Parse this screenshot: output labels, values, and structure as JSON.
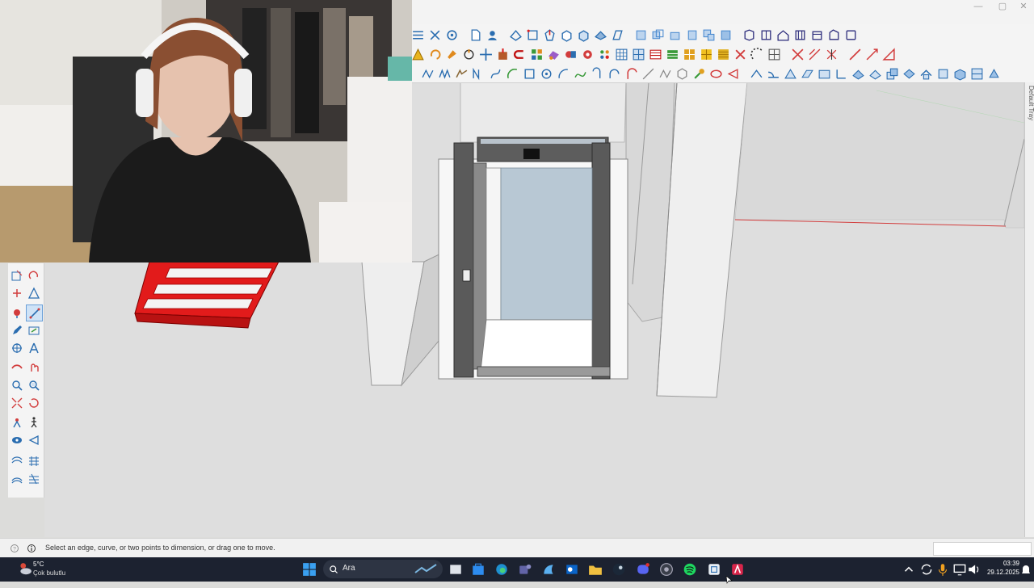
{
  "window": {
    "minimize": "—",
    "maximize": "▢",
    "close": "✕"
  },
  "tray": {
    "label": "Default Tray"
  },
  "status": {
    "text": "Select an edge, curve, or two points to dimension, or drag one to move.",
    "measurements_value": ""
  },
  "taskbar": {
    "weather_temp": "5°C",
    "weather_desc": "Çok bulutlu",
    "search_label": "Ara",
    "clock_time": "03:39",
    "clock_date": "29.12.2025",
    "apps": [
      "start",
      "search",
      "widget",
      "task-view",
      "store",
      "edge",
      "teams",
      "copilot",
      "outlook",
      "file-explorer",
      "steam",
      "discord",
      "chrome",
      "spotify",
      "sketchup",
      "app-red"
    ]
  },
  "colors": {
    "taskbar": "#1c2230",
    "viewport": "#dedede",
    "stair_red": "#e21b1b",
    "axis_red": "#d23c3c",
    "toolbar_blue": "#2a6db0",
    "toolbar_orange": "#e08a1e"
  }
}
